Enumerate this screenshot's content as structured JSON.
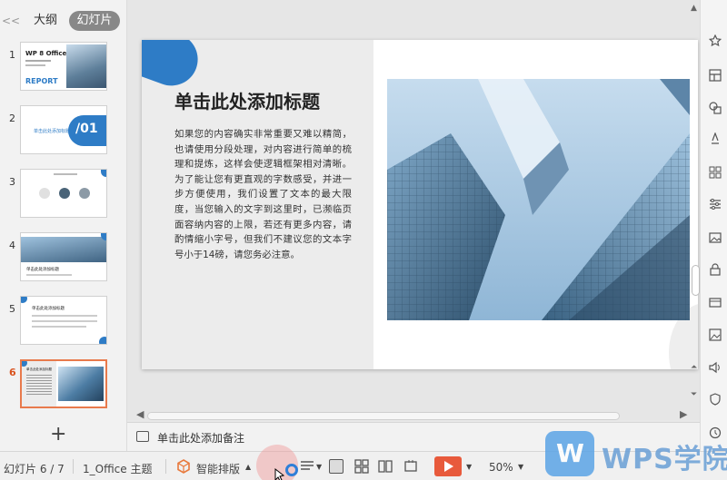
{
  "left_panel": {
    "tab_outline": "大纲",
    "tab_slides": "幻灯片",
    "collapse": "<<",
    "add_slide": "+",
    "thumbs": [
      {
        "num": "1",
        "line1": "WP 8 Office",
        "line2": "REPORT"
      },
      {
        "num": "2",
        "line1": "单击此处添加标题",
        "line2": "/01"
      },
      {
        "num": "3",
        "line1": "",
        "line2": ""
      },
      {
        "num": "4",
        "line1": "单击此处添加标题",
        "line2": ""
      },
      {
        "num": "5",
        "line1": "单击此处添加标题",
        "line2": ""
      },
      {
        "num": "6",
        "line1": "单击此处添加标题",
        "line2": ""
      }
    ]
  },
  "slide": {
    "title": "单击此处添加标题",
    "body": "如果您的内容确实非常重要又难以精简，也请使用分段处理，对内容进行简单的梳理和提炼，这样会使逻辑框架相对清晰。为了能让您有更直观的字数感受，并进一步方便使用，我们设置了文本的最大限度，当您输入的文字到这里时，已濒临页面容纳内容的上限，若还有更多内容，请酌情缩小字号，但我们不建议您的文本字号小于14磅，请您务必注意。"
  },
  "notes": {
    "placeholder": "单击此处添加备注"
  },
  "status": {
    "slide_counter": "幻灯片 6 / 7",
    "theme": "1_Office 主题",
    "smart_layout": "智能排版",
    "zoom": "50%",
    "watermark": "WPS学院",
    "watermark_logo": "W"
  },
  "colors": {
    "accent": "#2e7cc6",
    "play": "#e85a3c",
    "active_thumb_border": "#e87a4c"
  }
}
